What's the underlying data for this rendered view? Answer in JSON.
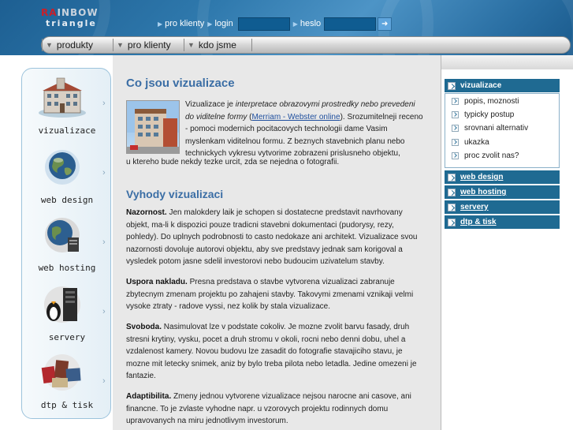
{
  "logo": {
    "line1_red": "RA",
    "line1_rest": "INBOW",
    "line2": "triangle"
  },
  "login": {
    "pro_klienty": "pro klienty",
    "login_label": "login",
    "login_value": "",
    "heslo_label": "heslo",
    "heslo_value": "",
    "go_icon": "arrow-go-icon"
  },
  "topnav": {
    "items": [
      {
        "label": "produkty"
      },
      {
        "label": "pro klienty"
      },
      {
        "label": "kdo jsme"
      }
    ]
  },
  "sidebar": {
    "items": [
      {
        "label": "vizualizace",
        "icon": "building-icon"
      },
      {
        "label": "web design",
        "icon": "globe-icon"
      },
      {
        "label": "web hosting",
        "icon": "globe-server-icon"
      },
      {
        "label": "servery",
        "icon": "server-tower-icon"
      },
      {
        "label": "dtp & tisk",
        "icon": "print-materials-icon"
      }
    ]
  },
  "content": {
    "title": "Co jsou vizualizace",
    "intro": {
      "p1": "Vizualizace je ",
      "p1_em": "interpretace obrazovymi prostredky nebo prevedeni do viditelne formy",
      "p1_open": " (",
      "link": "Merriam - Webster online",
      "p1_rest": "). Srozumitelneji receno - pomoci modernich pocitacovych technologii dame Vasim myslenkam viditelnou formu. Z beznych stavebnich planu nebo technickych vykresu vytvorime zobrazeni prislusneho objektu,",
      "p2": "u ktereho bude nekdy tezke urcit, zda se nejedna o fotografii."
    },
    "subtitle": "Vyhody vizualizaci",
    "paras": [
      {
        "bold": "Nazornost.",
        "text": " Jen malokdery laik je schopen si dostatecne predstavit navrhovany objekt, ma-li k dispozici pouze tradicni stavebni dokumentaci (pudorysy, rezy, pohledy). Do uplnych podrobnosti to casto nedokaze ani architekt. Vizualizace svou nazornosti dovoluje autorovi objektu, aby sve predstavy jednak sam korigoval a vysledek potom jasne sdelil investorovi nebo budoucim uzivatelum stavby."
      },
      {
        "bold": "Uspora nakladu.",
        "text": " Presna predstava o stavbe vytvorena vizualizaci zabranuje zbytecnym zmenam projektu po zahajeni stavby. Takovymi zmenami vznikaji velmi vysoke ztraty - radove vyssi, nez kolik by stala vizualizace."
      },
      {
        "bold": "Svoboda.",
        "text": " Nasimulovat lze v podstate cokoliv. Je mozne zvolit barvu fasady, druh stresni krytiny, vysku, pocet a druh stromu v okoli, rocni nebo denni dobu, uhel a vzdalenost kamery. Novou budovu lze zasadit do fotografie stavajiciho stavu, je mozne mit letecky snimek, aniz by bylo treba pilota nebo letadla. Jedine omezeni je fantazie."
      },
      {
        "bold": "Adaptibilita.",
        "text": " Zmeny jednou vytvorene vizualizace nejsou narocne ani casove, ani financne. To je zvlaste vyhodne napr. u vzorovych projektu rodinnych domu upravovanych na miru jednotlivym investorum."
      }
    ]
  },
  "rightnav": {
    "active": "vizualizace",
    "subitems": [
      "popis, moznosti",
      "typicky postup",
      "srovnani alternativ",
      "ukazka",
      "proc zvolit nas?"
    ],
    "others": [
      "web design",
      "web hosting",
      "servery",
      "dtp & tisk"
    ]
  },
  "colors": {
    "accent": "#3b6ea5",
    "nav_dark": "#1f6a92",
    "header": "#2f79ad"
  }
}
